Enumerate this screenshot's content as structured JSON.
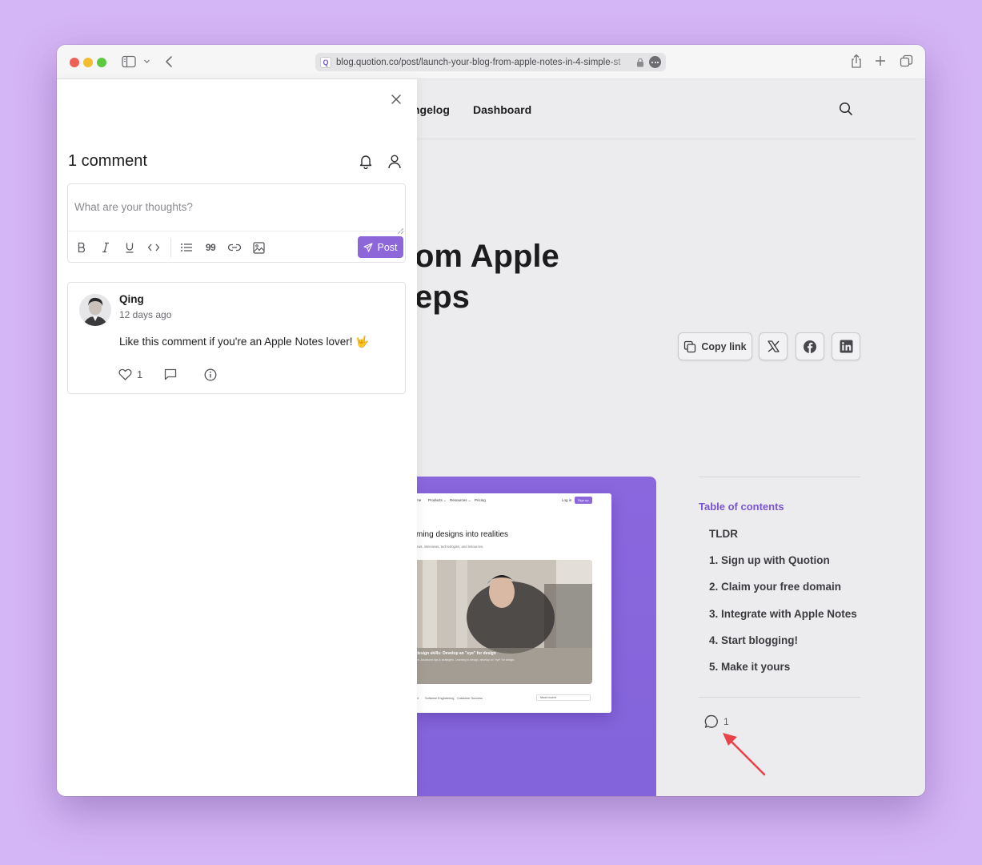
{
  "browser": {
    "url": "blog.quotion.co/post/launch-your-blog-from-apple-notes-in-4-simple-st",
    "favicon_letter": "Q"
  },
  "site": {
    "nav": [
      "ngelog",
      "Dashboard"
    ],
    "headline": [
      "om Apple",
      "eps"
    ],
    "share": {
      "copy_label": "Copy link"
    },
    "hero": {
      "nav": [
        "me",
        "Products ⌄",
        "Resources ⌄",
        "Pricing"
      ],
      "login": "Log in",
      "signup": "Sign up",
      "title": "ming designs into realities",
      "subtitle": "ews, interviews, technologies, and resources.",
      "caption": "design skills: Develop an \"eye\" for design",
      "caption_sub": "ce. Advanced tips & strategies. Learning to design, develop an \"eye\" for design.",
      "footer": [
        "ct",
        "Software Engineering",
        "Customer Success"
      ],
      "sort": "Most recent"
    },
    "toc": {
      "title": "Table of contents",
      "items": [
        "TLDR",
        "1. Sign up with Quotion",
        "2. Claim your free domain",
        "3. Integrate with Apple Notes",
        "4. Start blogging!",
        "5. Make it yours"
      ]
    },
    "comment_count": "1"
  },
  "comments": {
    "title": "1 comment",
    "placeholder": "What are your thoughts?",
    "post_label": "Post",
    "items": [
      {
        "author": "Qing",
        "time": "12 days ago",
        "text": "Like this comment if you're an Apple Notes lover! 🤟",
        "likes": "1"
      }
    ]
  },
  "colors": {
    "accent": "#8d66da",
    "background": "#d4b5f5",
    "arrow": "#e8434b"
  }
}
